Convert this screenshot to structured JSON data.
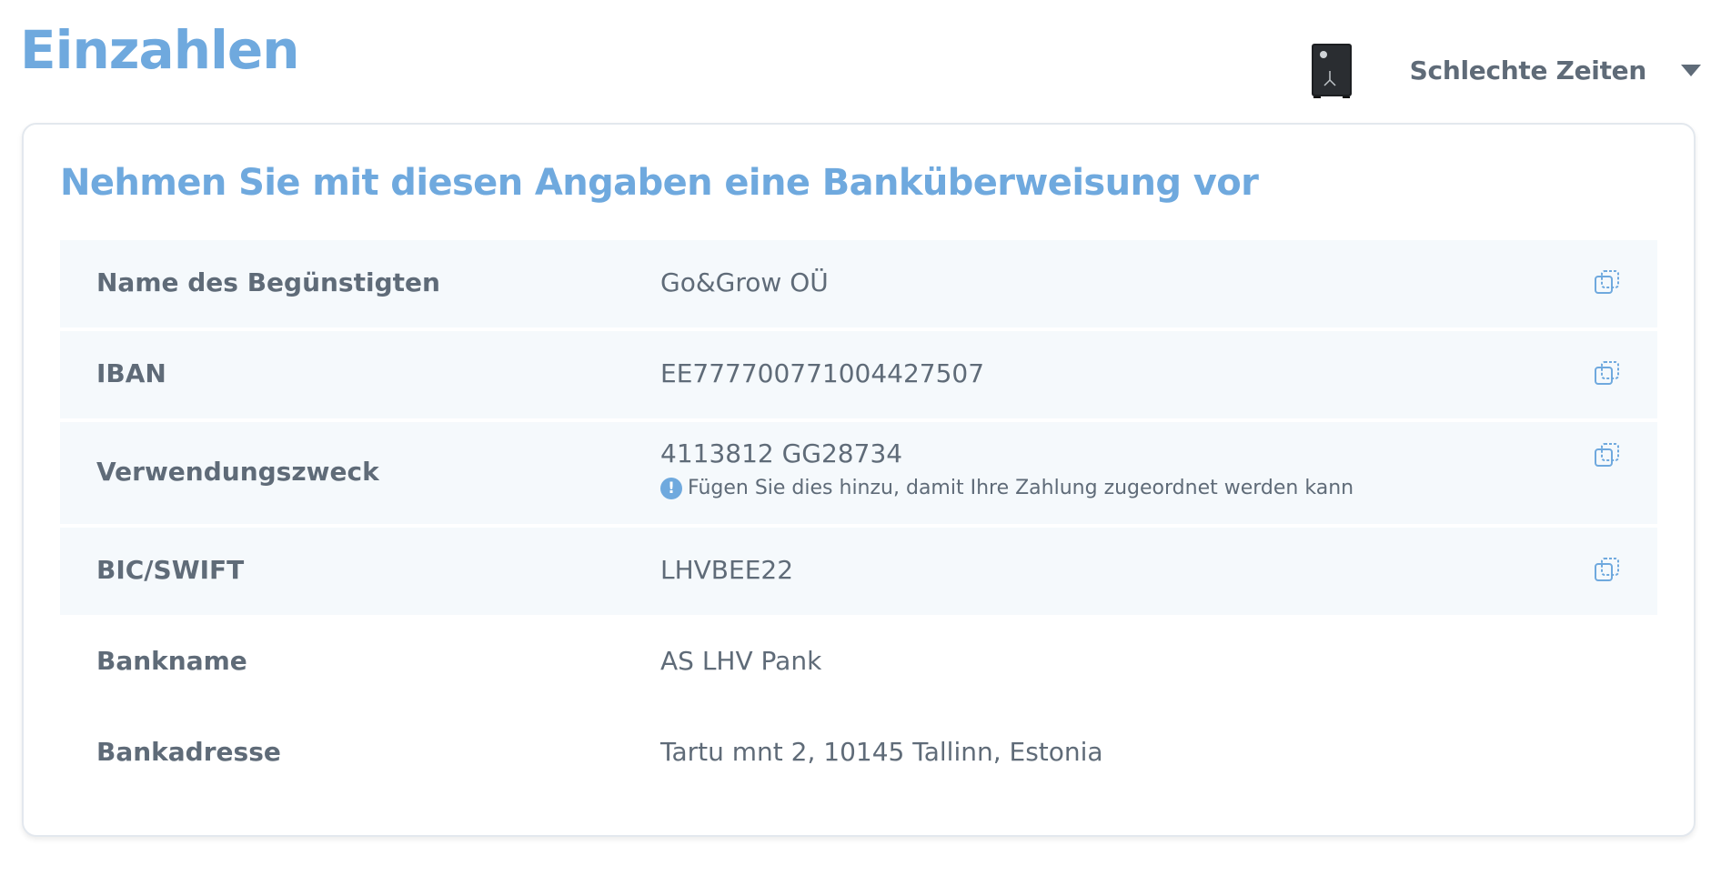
{
  "header": {
    "title": "Einzahlen",
    "account_name": "Schlechte Zeiten"
  },
  "card": {
    "title": "Nehmen Sie mit diesen Angaben eine Banküberweisung vor",
    "rows": [
      {
        "label": "Name des Begünstigten",
        "value": "Go&Grow OÜ",
        "copyable": true
      },
      {
        "label": "IBAN",
        "value": "EE777700771004427507",
        "copyable": true
      },
      {
        "label": "Verwendungszweck",
        "value": "4113812 GG28734",
        "note": "Fügen Sie dies hinzu, damit Ihre Zahlung zugeordnet werden kann",
        "copyable": true
      },
      {
        "label": "BIC/SWIFT",
        "value": "LHVBEE22",
        "copyable": true
      },
      {
        "label": "Bankname",
        "value": "AS LHV Pank",
        "copyable": false
      },
      {
        "label": "Bankadresse",
        "value": "Tartu mnt 2, 10145 Tallinn, Estonia",
        "copyable": false
      }
    ]
  },
  "colors": {
    "accent": "#6fa9de",
    "text": "#5f6b78",
    "row_shade": "#f5f9fc"
  },
  "icons": {
    "copy": "copy-icon",
    "info": "info-icon",
    "dropdown": "chevron-down-icon",
    "account": "safe-icon"
  }
}
